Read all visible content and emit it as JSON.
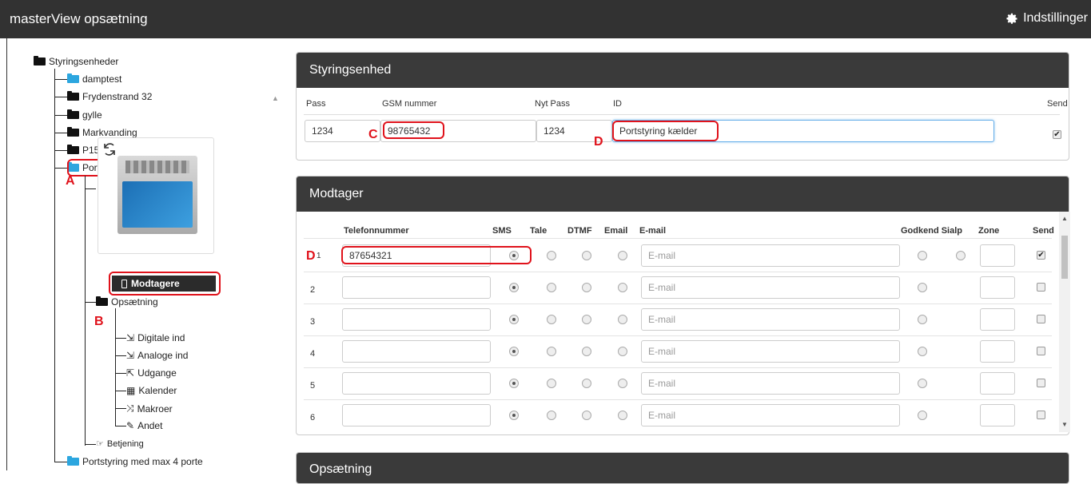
{
  "app": {
    "title": "masterView opsætning",
    "settings_label": "Indstillinger"
  },
  "tree": {
    "root": "Styringsenheder",
    "units": [
      "damptest",
      "Frydenstrand 32",
      "gylle",
      "Markvanding",
      "P15 21954117",
      "Portstyring kælder"
    ],
    "setup_folder": "Opsætning",
    "setup_items": [
      "Modtagere",
      "Digitale ind",
      "Analoge ind",
      "Udgange",
      "Kalender",
      "Makroer",
      "Andet"
    ],
    "operation": "Betjening",
    "last_unit": "Portstyring med max 4 porte"
  },
  "annotations": {
    "a": "A",
    "b": "B",
    "c": "C",
    "d": "D",
    "d2": "D"
  },
  "unit_panel": {
    "title": "Styringsenhed",
    "labels": {
      "pass": "Pass",
      "gsm": "GSM nummer",
      "new_pass": "Nyt Pass",
      "id": "ID",
      "send": "Send"
    },
    "values": {
      "pass": "1234",
      "gsm": "98765432",
      "new_pass": "1234",
      "id": "Portstyring kælder"
    },
    "send_checked": true
  },
  "receiver_panel": {
    "title": "Modtager",
    "columns": {
      "phone": "Telefonnummer",
      "sms": "SMS",
      "tale": "Tale",
      "dtmf": "DTMF",
      "email_opt": "Email",
      "email": "E-mail",
      "godkend": "Godkend Sialp",
      "zone": "Zone",
      "send": "Send"
    },
    "email_placeholder": "E-mail",
    "rows": [
      {
        "num": "1",
        "phone": "87654321",
        "sms": true,
        "send": true
      },
      {
        "num": "2",
        "phone": "",
        "sms": true,
        "send": false
      },
      {
        "num": "3",
        "phone": "",
        "sms": true,
        "send": false
      },
      {
        "num": "4",
        "phone": "",
        "sms": true,
        "send": false
      },
      {
        "num": "5",
        "phone": "",
        "sms": true,
        "send": false
      },
      {
        "num": "6",
        "phone": "",
        "sms": true,
        "send": false
      }
    ]
  },
  "setup_panel": {
    "title": "Opsætning"
  },
  "colors": {
    "topbar": "#323232",
    "panel_header": "#3a3a3a",
    "annotation_red": "#e0121b",
    "folder_blue": "#2ca6df"
  }
}
